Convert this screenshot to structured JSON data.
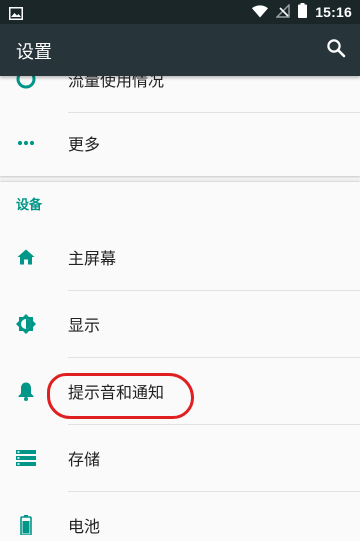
{
  "status_bar": {
    "time": "15:16",
    "icons": [
      "image-notification-icon",
      "wifi-icon",
      "no-signal-icon",
      "battery-icon"
    ]
  },
  "app_bar": {
    "title": "设置",
    "search_icon": "search-icon"
  },
  "colors": {
    "status_bar": "#1b2629",
    "app_bar": "#27343a",
    "accent": "#009688",
    "annotation": "#e02020"
  },
  "sections": [
    {
      "items": [
        {
          "label": "流量使用情况",
          "icon": "data-usage-icon",
          "partially_visible": true
        },
        {
          "label": "更多",
          "icon": "more-icon"
        }
      ]
    },
    {
      "header": "设备",
      "items": [
        {
          "label": "主屏幕",
          "icon": "home-icon"
        },
        {
          "label": "显示",
          "icon": "brightness-icon"
        },
        {
          "label": "提示音和通知",
          "icon": "bell-icon",
          "highlighted": true
        },
        {
          "label": "存储",
          "icon": "storage-icon"
        },
        {
          "label": "电池",
          "icon": "battery-icon"
        }
      ]
    }
  ]
}
